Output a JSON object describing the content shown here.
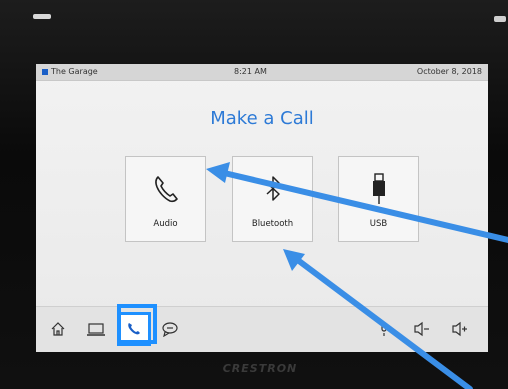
{
  "status_bar": {
    "room_name": "The Garage",
    "time": "8:21 AM",
    "date": "October 8, 2018"
  },
  "page": {
    "title": "Make a Call"
  },
  "tiles": [
    {
      "label": "Audio",
      "icon": "phone-handset-icon"
    },
    {
      "label": "Bluetooth",
      "icon": "bluetooth-icon"
    },
    {
      "label": "USB",
      "icon": "usb-plug-icon"
    }
  ],
  "nav_bar": {
    "items": [
      {
        "icon": "home-icon"
      },
      {
        "icon": "laptop-icon"
      },
      {
        "icon": "phone-icon",
        "selected": true
      },
      {
        "icon": "chat-bubble-icon"
      },
      {
        "icon": "microphone-icon"
      },
      {
        "icon": "volume-down-icon"
      },
      {
        "icon": "volume-up-icon"
      }
    ]
  },
  "device": {
    "brand": "CRESTRON"
  },
  "colors": {
    "accent": "#2d7ad6",
    "highlight": "#1e90ff",
    "annotation_arrow": "#3a8ee6"
  }
}
